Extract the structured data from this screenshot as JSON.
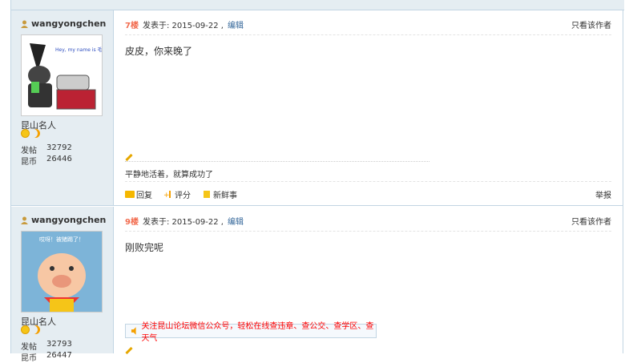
{
  "topbar": {},
  "posts": [
    {
      "username": "wangyongchen",
      "rank": "昆山名人",
      "stats": [
        {
          "label": "发帖",
          "value": "32792"
        },
        {
          "label": "昆币",
          "value": "26446"
        }
      ],
      "floor": "7楼",
      "posted_at": "发表于: 2015-09-22 ,",
      "edit_label": "编辑",
      "only_author": "只看该作者",
      "content": "皮皮，你来晚了",
      "signature": "平静地活着，就算成功了",
      "actions": {
        "reply": "回复",
        "rate": "评分",
        "fresh": "新鲜事"
      },
      "report": "举报",
      "avatar_text": "Hey, my name is 毛驴, nice to meet u~"
    },
    {
      "username": "wangyongchen",
      "rank": "昆山名人",
      "stats": [
        {
          "label": "发帖",
          "value": "32793"
        },
        {
          "label": "昆币",
          "value": "26447"
        }
      ],
      "floor": "9楼",
      "posted_at": "发表于: 2015-09-22 ,",
      "edit_label": "编辑",
      "only_author": "只看该作者",
      "content": "刚败完呢",
      "notice": "关注昆山论坛微信公众号，轻松在线查违章、查公交、查学区、查天气",
      "avatar_text": "哎呀！被猪踢了！"
    }
  ],
  "colors": {
    "side_bg": "#e5edf2",
    "border": "#c2d5e3",
    "floor": "#f26c4f",
    "link": "#336699",
    "notice": "#ff0000"
  }
}
